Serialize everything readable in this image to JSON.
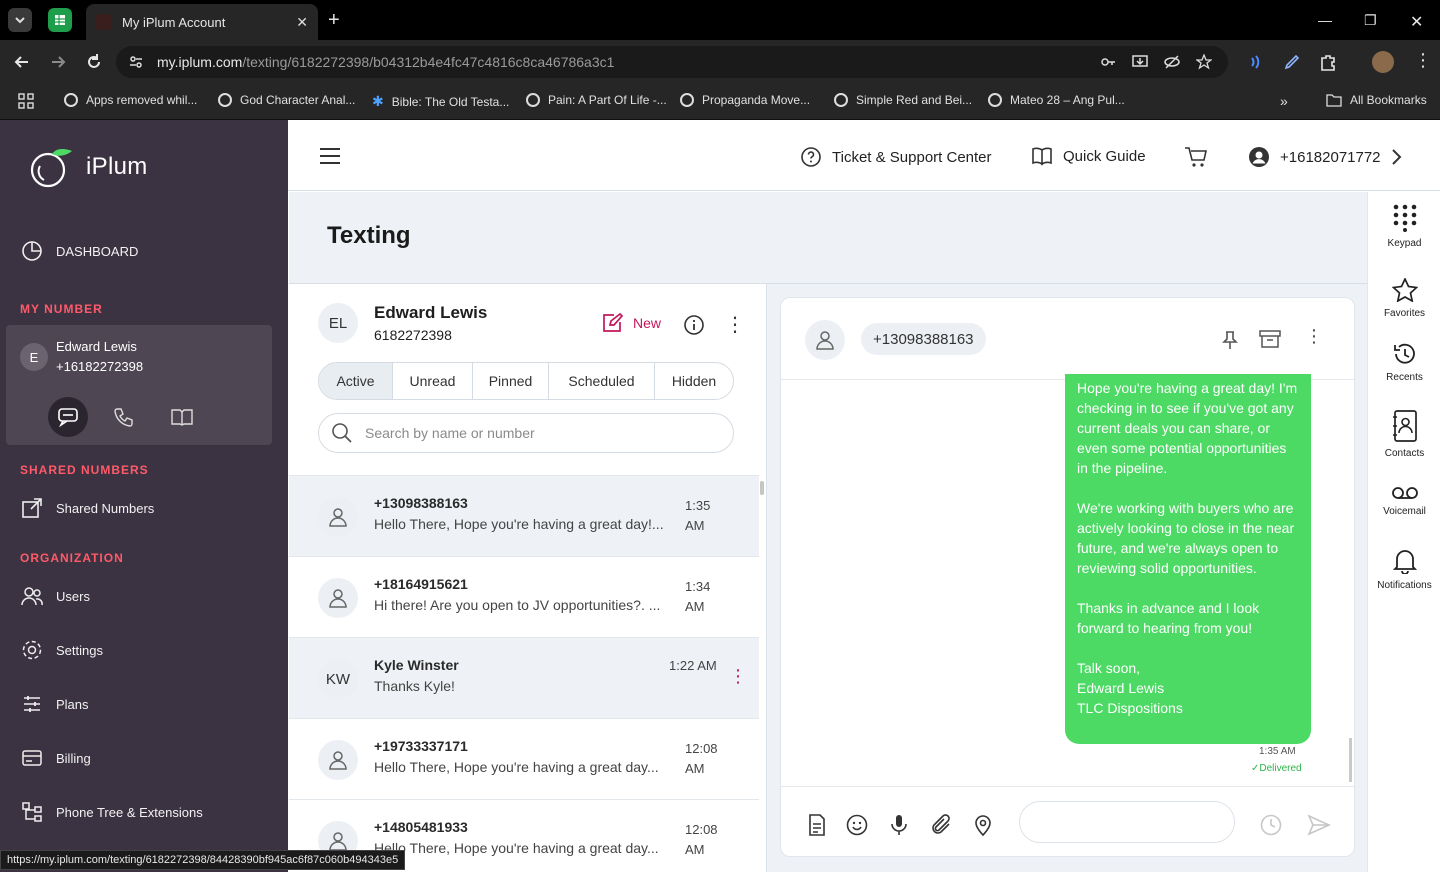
{
  "browser": {
    "tab_title": "My iPlum Account",
    "url_host": "my.iplum.com",
    "url_path": "/texting/6182272398/b04312b4e4fc47c4816c8ca46786a3c1",
    "bookmarks": [
      "Apps removed whil...",
      "God Character Anal...",
      "Bible: The Old Testa...",
      "Pain: A Part Of Life -...",
      "Propaganda Move...",
      "Simple Red and Bei...",
      "Mateo 28 – Ang Pul..."
    ],
    "all_bookmarks": "All Bookmarks",
    "status_url": "https://my.iplum.com/texting/6182272398/84428390bf945ac6f87c060b494343e5"
  },
  "sidebar": {
    "brand": "iPlum",
    "dashboard": "DASHBOARD",
    "my_number_heading": "MY NUMBER",
    "my_number": {
      "avatar": "E",
      "name": "Edward Lewis",
      "phone": "+16182272398"
    },
    "shared_heading": "SHARED NUMBERS",
    "shared_numbers": "Shared Numbers",
    "org_heading": "ORGANIZATION",
    "org_items": [
      "Users",
      "Settings",
      "Plans",
      "Billing",
      "Phone Tree & Extensions"
    ]
  },
  "topbar": {
    "support": "Ticket & Support Center",
    "guide": "Quick Guide",
    "account": "+16182071772"
  },
  "page_title": "Texting",
  "conversations": {
    "owner_initials": "EL",
    "owner_name": "Edward Lewis",
    "owner_number": "6182272398",
    "new_label": "New",
    "tabs": [
      "Active",
      "Unread",
      "Pinned",
      "Scheduled",
      "Hidden"
    ],
    "search_placeholder": "Search by name or number",
    "items": [
      {
        "avatar": "",
        "name": "+13098388163",
        "preview": "Hello There, Hope you're having a great day!...",
        "time1": "1:35",
        "time2": "AM"
      },
      {
        "avatar": "",
        "name": "+18164915621",
        "preview": "Hi there! Are you open to JV opportunities?. ...",
        "time1": "1:34",
        "time2": "AM"
      },
      {
        "avatar": "KW",
        "name": "Kyle Winster",
        "preview": "Thanks Kyle!",
        "time1": "1:22 AM",
        "time2": ""
      },
      {
        "avatar": "",
        "name": "+19733337171",
        "preview": "Hello There, Hope you're having a great day...",
        "time1": "12:08",
        "time2": "AM"
      },
      {
        "avatar": "",
        "name": "+14805481933",
        "preview": "Hello There, Hope you're having a great day...",
        "time1": "12:08",
        "time2": "AM"
      }
    ]
  },
  "chat": {
    "contact": "+13098388163",
    "message": "Hope you're having a great day! I'm checking in to see if you've got any current deals you can share, or even some potential opportunities in the pipeline.\n\nWe're working with buyers who are actively looking to close in the near future, and we're always open to reviewing solid opportunities.\n\nThanks in advance and I look forward to hearing from you!\n\nTalk soon,\nEdward Lewis\nTLC Dispositions",
    "time": "1:35 AM",
    "status": "✓Delivered"
  },
  "right_rail": [
    "Keypad",
    "Favorites",
    "Recents",
    "Contacts",
    "Voicemail",
    "Notifications"
  ],
  "colors": {
    "sidebar": "#3b3341",
    "accent": "#c2185b",
    "section": "#ff5a6a",
    "bubble": "#4cd964"
  }
}
